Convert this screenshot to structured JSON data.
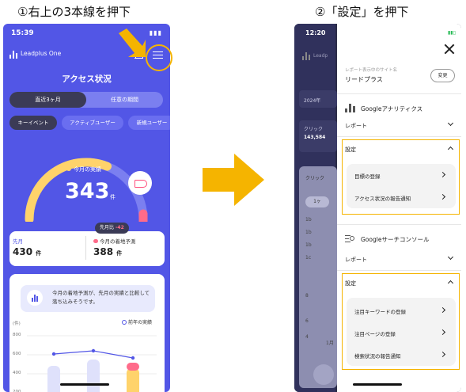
{
  "captions": {
    "step1": "①右上の3本線を押下",
    "step2": "②「設定」を押下"
  },
  "left": {
    "status_time": "15:39",
    "app_name": "Leadplus One",
    "page_title": "アクセス状況",
    "segments": [
      "直近3ヶ月",
      "任意の期間"
    ],
    "chips": [
      "キーイベント",
      "アクティブユーザー",
      "新規ユーザー"
    ],
    "gauge": {
      "label": "今月の実績",
      "value": "343",
      "unit": "件",
      "fill_fraction": 0.62
    },
    "diff_pill": {
      "label": "先月比",
      "value": "-42"
    },
    "last_month": {
      "label": "先月",
      "value": "430",
      "unit": "件"
    },
    "forecast": {
      "label": "今月の着地予測",
      "value": "388",
      "unit": "件"
    },
    "tip_text": "今月の着地予測が、先月の実績と比較して落ち込みそうです。",
    "chart_legend": "前年の実績",
    "chart_yticks": [
      "(件)",
      "800",
      "600",
      "400",
      "200"
    ],
    "colors": {
      "bg": "#5256e6",
      "accent": "#f5b400",
      "forecast": "#ff6b8a"
    }
  },
  "right": {
    "status_time": "12:20",
    "bg_app_name": "Leadp",
    "bg_date": "2024年",
    "bg_label1": "クリック",
    "bg_value1": "143,584",
    "bg_label2": "クリック",
    "bg_chip": "1ヶ",
    "bg_month": "1月",
    "bg_ticks": [
      "1b",
      "1b",
      "1b",
      "1c",
      "8",
      "6",
      "4"
    ],
    "site_caption": "レポート表示中のサイト名",
    "site_name": "リードプラス",
    "change_button": "変更",
    "ga": {
      "title": "Googleアナリティクス",
      "report": "レポート",
      "settings": "設定",
      "items": [
        "目標の登録",
        "アクセス状況の報告通知"
      ]
    },
    "gsc": {
      "title": "Googleサーチコンソール",
      "report": "レポート",
      "settings": "設定",
      "items": [
        "注目キーワードの登録",
        "注目ページの登録",
        "検索状況の報告通知"
      ]
    }
  }
}
